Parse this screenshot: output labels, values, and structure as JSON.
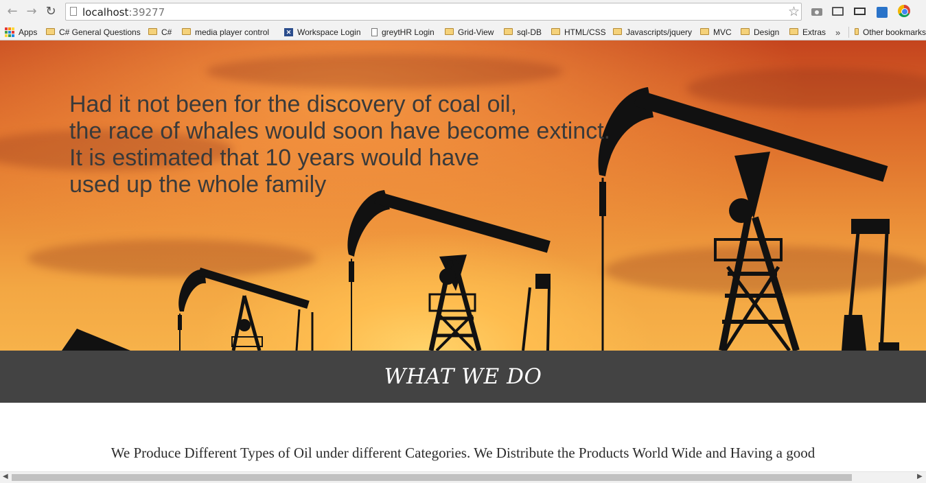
{
  "browser": {
    "url_host": "localhost",
    "url_port": ":39277",
    "back_icon": "back-arrow-icon",
    "forward_icon": "forward-arrow-icon",
    "reload_icon": "reload-icon"
  },
  "bookmarks": {
    "items": [
      {
        "label": "Apps",
        "icon": "apps-grid-icon"
      },
      {
        "label": "C# General Questions",
        "icon": "folder-icon"
      },
      {
        "label": "C#",
        "icon": "folder-icon"
      },
      {
        "label": "media player control ",
        "icon": "folder-icon"
      },
      {
        "label": "Workspace Login",
        "icon": "workspace-icon"
      },
      {
        "label": "greytHR Login",
        "icon": "page-icon"
      },
      {
        "label": "Grid-View",
        "icon": "folder-icon"
      },
      {
        "label": "sql-DB",
        "icon": "folder-icon"
      },
      {
        "label": "HTML/CSS",
        "icon": "folder-icon"
      },
      {
        "label": "Javascripts/jquery",
        "icon": "folder-icon"
      },
      {
        "label": "MVC",
        "icon": "folder-icon"
      },
      {
        "label": "Design",
        "icon": "folder-icon"
      },
      {
        "label": "Extras",
        "icon": "folder-icon"
      }
    ],
    "overflow": "»",
    "other": "Other bookmarks"
  },
  "hero": {
    "quote_lines": [
      "Had it not been for the discovery of coal oil,",
      "the race of whales would soon have become extinct.",
      "It is estimated that 10 years would have",
      "used up the whole family"
    ]
  },
  "section": {
    "title": "WHAT WE DO",
    "text": "We Produce Different Types of Oil under different Categories. We Distribute the Products World Wide and Having a good"
  },
  "colors": {
    "band": "#434343",
    "sky_top": "#c4441e",
    "sky_bottom": "#f7b24a"
  }
}
